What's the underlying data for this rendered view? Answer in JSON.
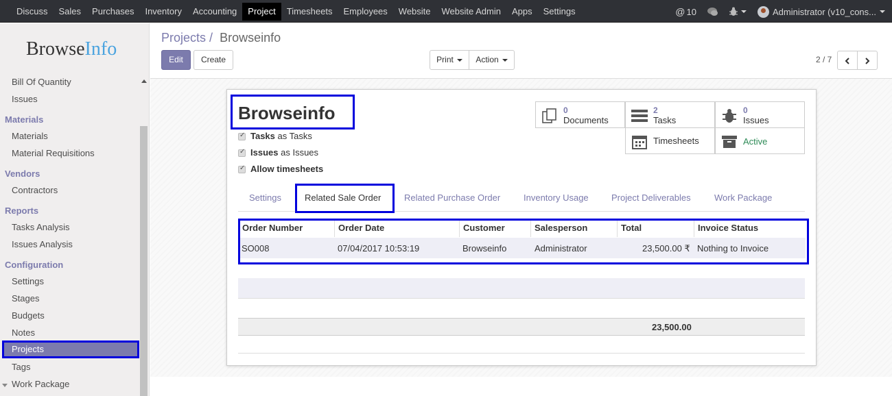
{
  "topnav": {
    "menu": [
      "Discuss",
      "Sales",
      "Purchases",
      "Inventory",
      "Accounting",
      "Project",
      "Timesheets",
      "Employees",
      "Website",
      "Website Admin",
      "Apps",
      "Settings"
    ],
    "active": "Project",
    "mentions": "10",
    "user": "Administrator (v10_cons..."
  },
  "sidebar": {
    "logo_a": "Browse",
    "logo_b": "Info",
    "items_top": [
      "Bill Of Quantity",
      "Issues"
    ],
    "cat_materials": "Materials",
    "materials": [
      "Materials",
      "Material Requisitions"
    ],
    "cat_vendors": "Vendors",
    "vendors": [
      "Contractors"
    ],
    "cat_reports": "Reports",
    "reports": [
      "Tasks Analysis",
      "Issues Analysis"
    ],
    "cat_config": "Configuration",
    "config": [
      "Settings",
      "Stages",
      "Budgets",
      "Notes",
      "Projects",
      "Tags",
      "Work Package"
    ]
  },
  "breadcrumb": {
    "parent": "Projects",
    "sep": "/",
    "current": "Browseinfo"
  },
  "buttons": {
    "edit": "Edit",
    "create": "Create",
    "print": "Print",
    "action": "Action"
  },
  "pager": "2 / 7",
  "form": {
    "title": "Browseinfo",
    "checks": [
      {
        "bold": "Tasks",
        "rest": "as Tasks"
      },
      {
        "bold": "Issues",
        "rest": "as Issues"
      },
      {
        "bold": "Allow timesheets",
        "rest": ""
      }
    ],
    "smart": {
      "documents": {
        "num": "0",
        "label": "Documents"
      },
      "tasks": {
        "num": "2",
        "label": "Tasks"
      },
      "issues": {
        "num": "0",
        "label": "Issues"
      },
      "timesheets": {
        "label": "Timesheets"
      },
      "active": {
        "label": "Active"
      }
    },
    "tabs": [
      "Settings",
      "Related Sale Order",
      "Related Purchase Order",
      "Inventory Usage",
      "Project Deliverables",
      "Work Package"
    ],
    "active_tab": "Related Sale Order",
    "table": {
      "headers": [
        "Order Number",
        "Order Date",
        "Customer",
        "Salesperson",
        "Total",
        "Invoice Status"
      ],
      "rows": [
        [
          "SO008",
          "07/04/2017 10:53:19",
          "Browseinfo",
          "Administrator",
          "23,500.00 ₹",
          "Nothing to Invoice"
        ]
      ],
      "footer_total": "23,500.00"
    }
  },
  "colors": {
    "accent": "#7c7bad",
    "highlight": "#0000dd",
    "active_green": "#2e8b57"
  }
}
